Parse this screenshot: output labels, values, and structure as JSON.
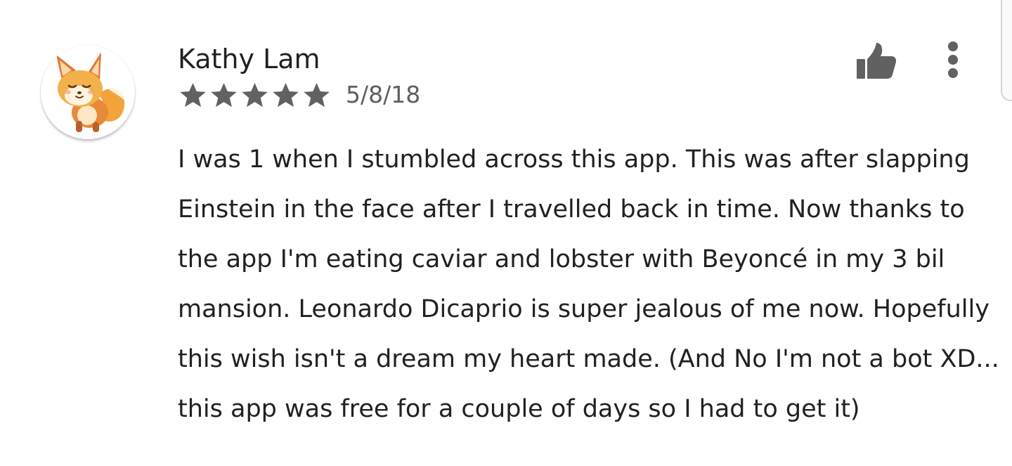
{
  "review": {
    "reviewer_name": "Kathy Lam",
    "rating": 5,
    "rating_max": 5,
    "date": "5/8/18",
    "body_lines": [
      "I was 1 when I stumbled across this app. This was after slapping",
      "Einstein in the face after I travelled back in time. Now thanks to",
      "the app I'm eating caviar and lobster with Beyoncé in my 3 bil",
      "mansion. Leonardo Dicaprio is super jealous of me now. Hopefully",
      "this wish isn't a dream my heart made. (And No I'm not a bot XD...",
      "this app was free for a couple of days so I had to get it)"
    ]
  },
  "icons": {
    "avatar": "fox-avatar",
    "helpful": "thumbs-up-icon",
    "menu": "more-vert-icon",
    "star": "star-icon"
  },
  "colors": {
    "text_primary": "#212121",
    "text_secondary": "#5f5f5f",
    "icon_gray": "#616161",
    "star_gray": "#616161"
  }
}
